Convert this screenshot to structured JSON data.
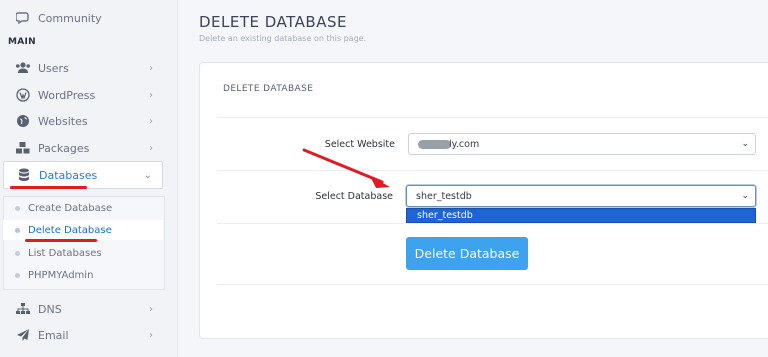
{
  "sidebar": {
    "community_label": "Community",
    "section_main": "MAIN",
    "items": [
      {
        "label": "Users",
        "icon": "users-icon"
      },
      {
        "label": "WordPress",
        "icon": "wordpress-icon"
      },
      {
        "label": "Websites",
        "icon": "globe-icon"
      },
      {
        "label": "Packages",
        "icon": "cubes-icon"
      },
      {
        "label": "Databases",
        "icon": "database-icon"
      },
      {
        "label": "DNS",
        "icon": "sitemap-icon"
      },
      {
        "label": "Email",
        "icon": "paper-plane-icon"
      }
    ],
    "chevron_right": "›",
    "chevron_down": "⌄",
    "db_submenu": [
      {
        "label": "Create Database"
      },
      {
        "label": "Delete Database"
      },
      {
        "label": "List Databases"
      },
      {
        "label": "PHPMYAdmin"
      }
    ]
  },
  "page": {
    "title": "DELETE DATABASE",
    "subtitle": "Delete an existing database on this page."
  },
  "card": {
    "title": "DELETE DATABASE",
    "website_label": "Select Website",
    "website_value_suffix": "ly.com",
    "database_label": "Select Database",
    "database_value": "sher_testdb",
    "dropdown_option": "sher_testdb",
    "caret": "⌄",
    "delete_button": "Delete Database"
  },
  "colors": {
    "accent": "#3da3ee",
    "annotation": "#e11b23",
    "selected_option": "#1f64d4",
    "active_link": "#1c6fd1"
  }
}
